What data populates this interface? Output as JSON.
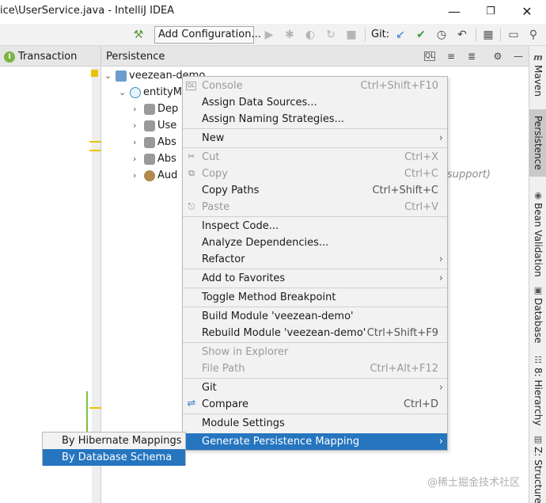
{
  "window": {
    "title": "ice\\UserService.java - IntelliJ IDEA",
    "controls": [
      "minimize",
      "maximize",
      "close"
    ]
  },
  "toolbar": {
    "add_configuration": "Add Configuration...",
    "git_label": "Git:"
  },
  "left_panel": {
    "title": "Transaction",
    "icon_letter": "I"
  },
  "persistence_panel": {
    "title": "Persistence",
    "tree": [
      {
        "label": "veezean-demo",
        "expanded": true
      },
      {
        "label": "entityM",
        "expanded": true
      },
      {
        "label": "Dep"
      },
      {
        "label": "Use"
      },
      {
        "label": "Abs"
      },
      {
        "label": "Abs"
      },
      {
        "label": "Aud"
      }
    ],
    "hint_text": "support)"
  },
  "right_strip": {
    "tabs": [
      "Maven",
      "Persistence",
      "Bean Validation",
      "Database",
      "8: Hierarchy",
      "Z: Structure"
    ]
  },
  "context_menu": {
    "items": [
      {
        "label": "Console",
        "shortcut": "Ctrl+Shift+F10",
        "disabled": true
      },
      {
        "label": "Assign Data Sources...",
        "shortcut": ""
      },
      {
        "label": "Assign Naming Strategies...",
        "shortcut": ""
      },
      {
        "label": "New",
        "shortcut": "",
        "submenu": true
      },
      {
        "label": "Cut",
        "shortcut": "Ctrl+X",
        "disabled": true
      },
      {
        "label": "Copy",
        "shortcut": "Ctrl+C",
        "disabled": true
      },
      {
        "label": "Copy Paths",
        "shortcut": "Ctrl+Shift+C"
      },
      {
        "label": "Paste",
        "shortcut": "Ctrl+V",
        "disabled": true
      },
      {
        "label": "Inspect Code...",
        "shortcut": ""
      },
      {
        "label": "Analyze Dependencies...",
        "shortcut": ""
      },
      {
        "label": "Refactor",
        "shortcut": "",
        "submenu": true
      },
      {
        "label": "Add to Favorites",
        "shortcut": "",
        "submenu": true
      },
      {
        "label": "Toggle Method Breakpoint",
        "shortcut": ""
      },
      {
        "label": "Build Module 'veezean-demo'",
        "shortcut": ""
      },
      {
        "label": "Rebuild Module 'veezean-demo'",
        "shortcut": "Ctrl+Shift+F9"
      },
      {
        "label": "Show in Explorer",
        "shortcut": "",
        "disabled": true
      },
      {
        "label": "File Path",
        "shortcut": "Ctrl+Alt+F12",
        "disabled": true
      },
      {
        "label": "Git",
        "shortcut": "",
        "submenu": true
      },
      {
        "label": "Compare",
        "shortcut": "Ctrl+D"
      },
      {
        "label": "Module Settings",
        "shortcut": ""
      },
      {
        "label": "Generate Persistence Mapping",
        "shortcut": "",
        "submenu": true,
        "selected": true
      }
    ]
  },
  "submenu": {
    "items": [
      {
        "label": "By Hibernate Mappings"
      },
      {
        "label": "By Database Schema",
        "selected": true
      }
    ]
  },
  "watermark": "@稀土掘金技术社区",
  "colors": {
    "selection": "#2675bf",
    "menu_bg": "#f2f2f2",
    "panel_header": "#e6e6e6",
    "gutter_mark": "#e8c400"
  }
}
